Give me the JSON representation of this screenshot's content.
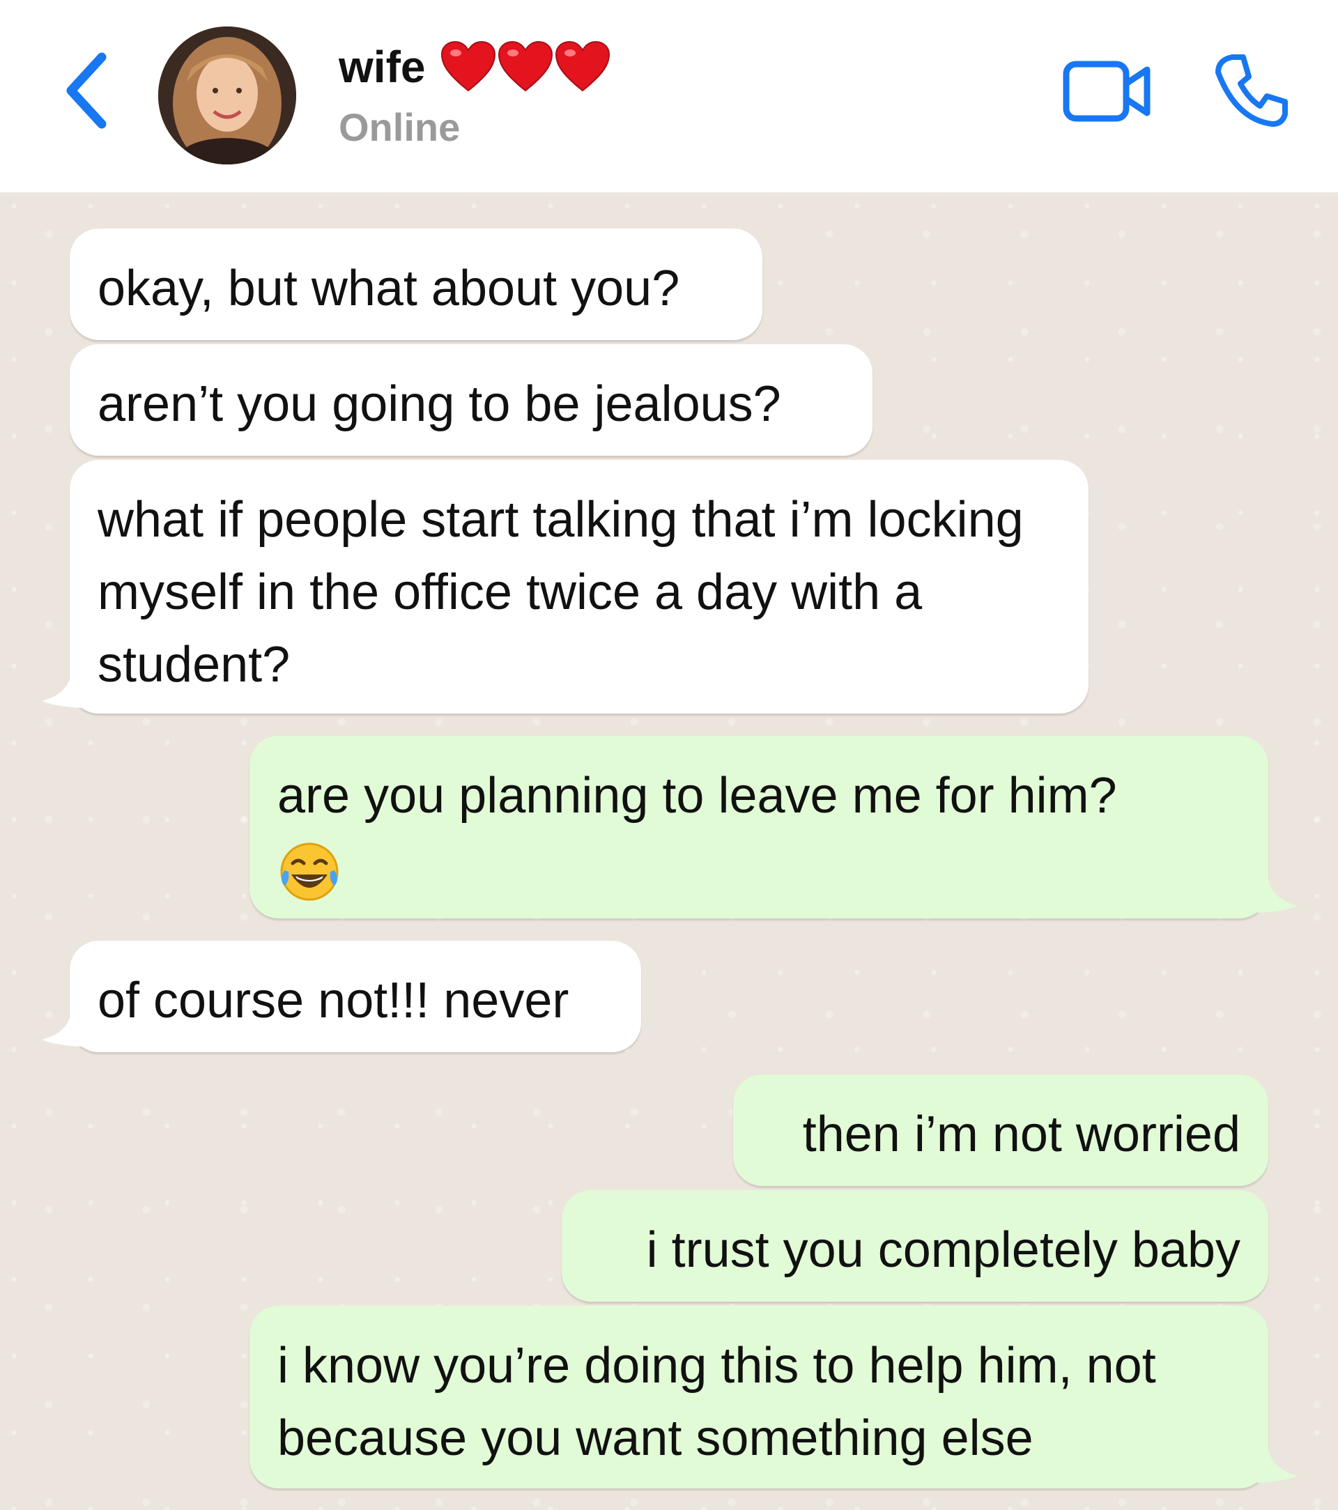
{
  "header": {
    "contact_name": "wife",
    "status": "Online",
    "hearts_icon": "red-heart-icon"
  },
  "messages": [
    {
      "direction": "incoming",
      "text": "okay, but what about you?"
    },
    {
      "direction": "incoming",
      "text": "aren’t you going to be jealous?"
    },
    {
      "direction": "incoming",
      "text": "what if people start talking that i’m locking myself in the office twice a day with a student?"
    },
    {
      "direction": "outgoing",
      "text": "are you planning to leave me for him?",
      "emoji": "tears-of-joy-emoji"
    },
    {
      "direction": "incoming",
      "text": "of course not!!! never"
    },
    {
      "direction": "outgoing",
      "text": "then i’m not worried"
    },
    {
      "direction": "outgoing",
      "text": "i trust you completely baby"
    },
    {
      "direction": "outgoing",
      "text": "i know you’re doing this to help him, not because you want something else"
    }
  ],
  "colors": {
    "accent": "#1877f2",
    "incoming_bubble": "#ffffff",
    "outgoing_bubble": "#e1fbd6",
    "chat_background": "#ece5dd",
    "status_text": "#9a9a9a"
  }
}
